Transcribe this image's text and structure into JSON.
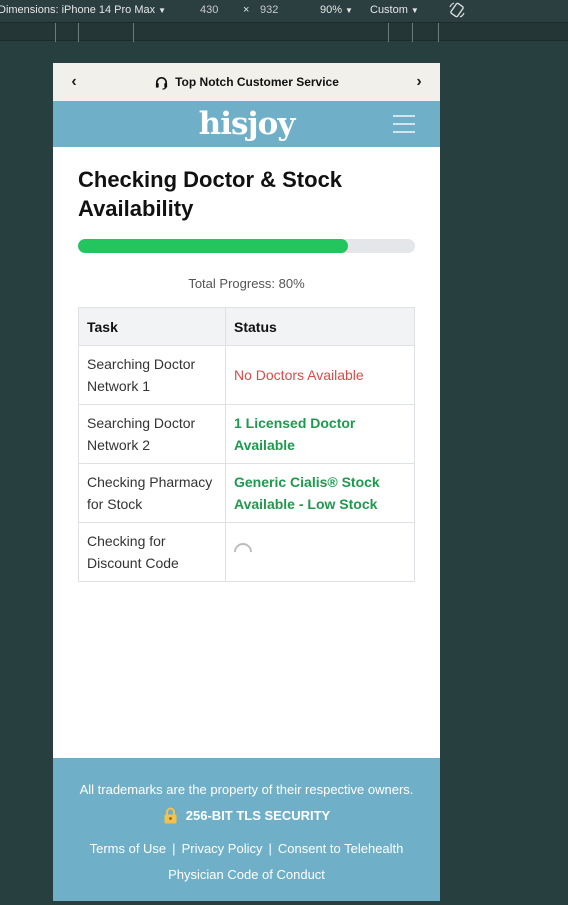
{
  "devtools": {
    "dimensions_label": "Dimensions: iPhone 14 Pro Max",
    "width": "430",
    "times": "×",
    "height": "932",
    "zoom": "90%",
    "throttle": "Custom"
  },
  "topbar": {
    "title": "Top Notch Customer Service",
    "prev_icon": "chevron-left-icon",
    "next_icon": "chevron-right-icon",
    "support_icon": "headset-icon"
  },
  "header": {
    "logo": "hisjoy",
    "menu_icon": "hamburger-icon"
  },
  "main": {
    "title": "Checking Doctor & Stock Availability",
    "progress_percent": 80,
    "progress_text": "Total Progress: 80%",
    "table": {
      "headers": [
        "Task",
        "Status"
      ],
      "rows": [
        {
          "task": "Searching Doctor Network 1",
          "status": "No Doctors Available",
          "state": "error"
        },
        {
          "task": "Searching Doctor Network 2",
          "status": "1 Licensed Doctor Available",
          "state": "success"
        },
        {
          "task": "Checking Pharmacy for Stock",
          "status": "Generic Cialis® Stock Available - Low Stock",
          "state": "success"
        },
        {
          "task": "Checking for Discount Code",
          "status": "",
          "state": "loading"
        }
      ]
    }
  },
  "footer": {
    "trademark": "All trademarks are the property of their respective owners.",
    "security": "256-BIT TLS SECURITY",
    "links": [
      "Terms of Use",
      "Privacy Policy",
      "Consent to Telehealth",
      "Physician Code of Conduct"
    ],
    "separator": "|"
  },
  "colors": {
    "brand": "#6fb0c8",
    "progress": "#22c55e",
    "error": "#e04848",
    "success": "#1e9a4d"
  }
}
